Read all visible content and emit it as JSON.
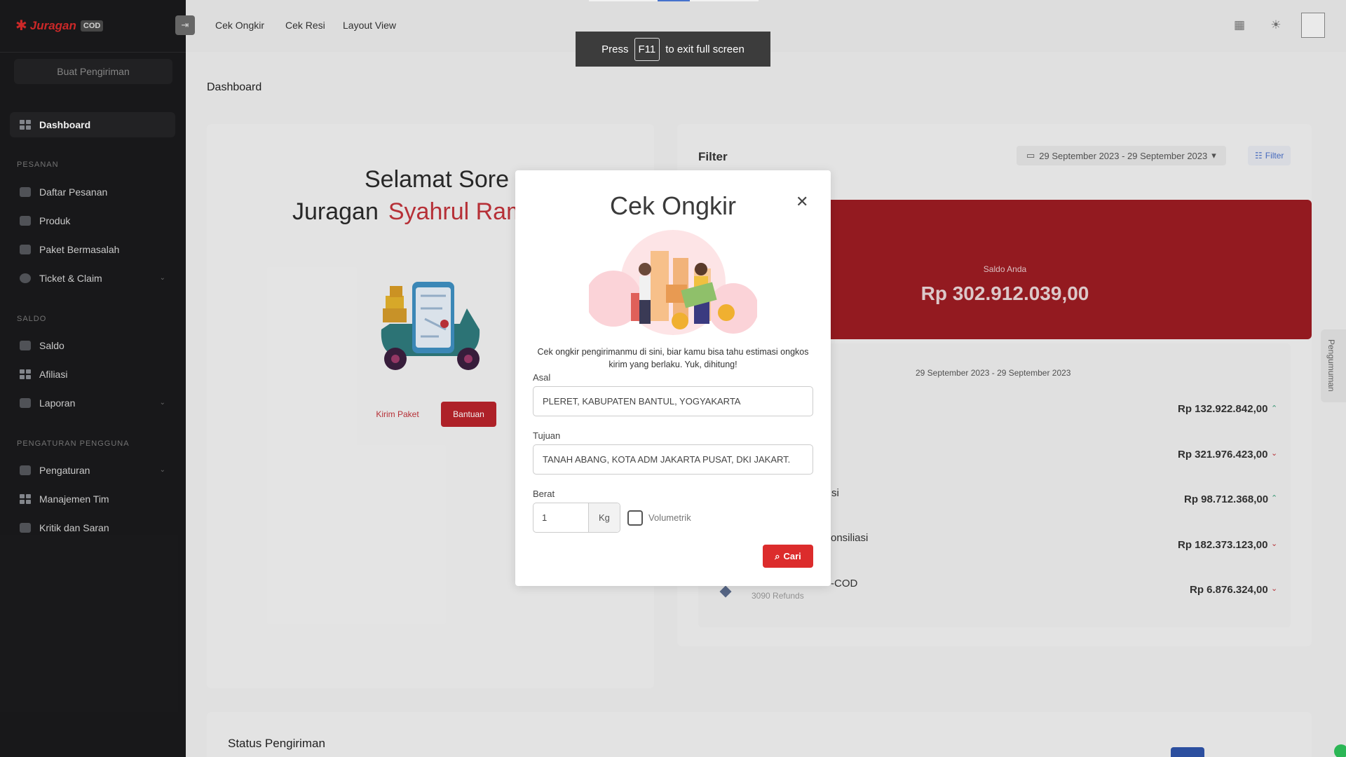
{
  "brand": {
    "name": "Juragan",
    "badge": "COD"
  },
  "sidebar": {
    "create_button": "Buat Pengiriman",
    "sections": {
      "pesanan": "PESANAN",
      "saldo": "SALDO",
      "pengaturan": "PENGATURAN PENGGUNA"
    },
    "items": [
      {
        "label": "Dashboard"
      },
      {
        "label": "Daftar Pesanan"
      },
      {
        "label": "Produk"
      },
      {
        "label": "Paket Bermasalah"
      },
      {
        "label": "Ticket & Claim"
      },
      {
        "label": "Saldo"
      },
      {
        "label": "Afiliasi"
      },
      {
        "label": "Laporan"
      },
      {
        "label": "Pengaturan"
      },
      {
        "label": "Manajemen Tim"
      },
      {
        "label": "Kritik dan Saran"
      }
    ]
  },
  "topbar": {
    "links": [
      "Cek Ongkir",
      "Cek Resi",
      "Layout View"
    ]
  },
  "fullscreen_toast": {
    "pre": "Press",
    "key": "F11",
    "post": "to exit full screen"
  },
  "page": {
    "title": "Dashboard"
  },
  "greeting": {
    "line1": "Selamat Sore",
    "prefix": "Juragan",
    "name": "Syahrul Rama"
  },
  "welcome_buttons": {
    "kirim": "Kirim Paket",
    "bantuan": "Bantuan"
  },
  "filter": {
    "title": "Filter",
    "date_range": "29 September 2023 - 29 September 2023",
    "button": "Filter"
  },
  "balance": {
    "label": "Saldo Anda",
    "value": "Rp 302.912.039,00"
  },
  "stats": {
    "range": "29 September 2023 - 29 September 2023",
    "rows": [
      {
        "value": "Rp 132.922.842,00",
        "label": "",
        "sub": ""
      },
      {
        "value": "Rp 321.976.423,00",
        "label": "",
        "sub": ""
      },
      {
        "value": "Rp 98.712.368,00",
        "label": "si",
        "sub": ""
      },
      {
        "value": "Rp 182.373.123,00",
        "label": "onsiliasi",
        "sub": ""
      },
      {
        "value": "Rp 6.876.324,00",
        "label": "-COD",
        "sub": "3090 Refunds"
      }
    ]
  },
  "status": {
    "title": "Status Pengiriman"
  },
  "side_tab": {
    "label": "Pengumuman"
  },
  "modal": {
    "title": "Cek Ongkir",
    "description": "Cek ongkir pengirimanmu di sini, biar kamu bisa tahu estimasi ongkos kirim yang berlaku. Yuk, dihitung!",
    "origin_label": "Asal",
    "origin_value": "PLERET, KABUPATEN BANTUL, YOGYAKARTA",
    "dest_label": "Tujuan",
    "dest_value": "TANAH ABANG, KOTA ADM JAKARTA PUSAT, DKI JAKART.",
    "weight_label": "Berat",
    "weight_value": "1",
    "weight_unit": "Kg",
    "volumetric_label": "Volumetrik",
    "volumetric_checked": false,
    "search_button": "Cari"
  },
  "colors": {
    "brand_red": "#dc2c2c",
    "sidebar_bg": "#1a1a1c",
    "balance_bg": "#9b1c22",
    "name_red": "#c0333a"
  }
}
